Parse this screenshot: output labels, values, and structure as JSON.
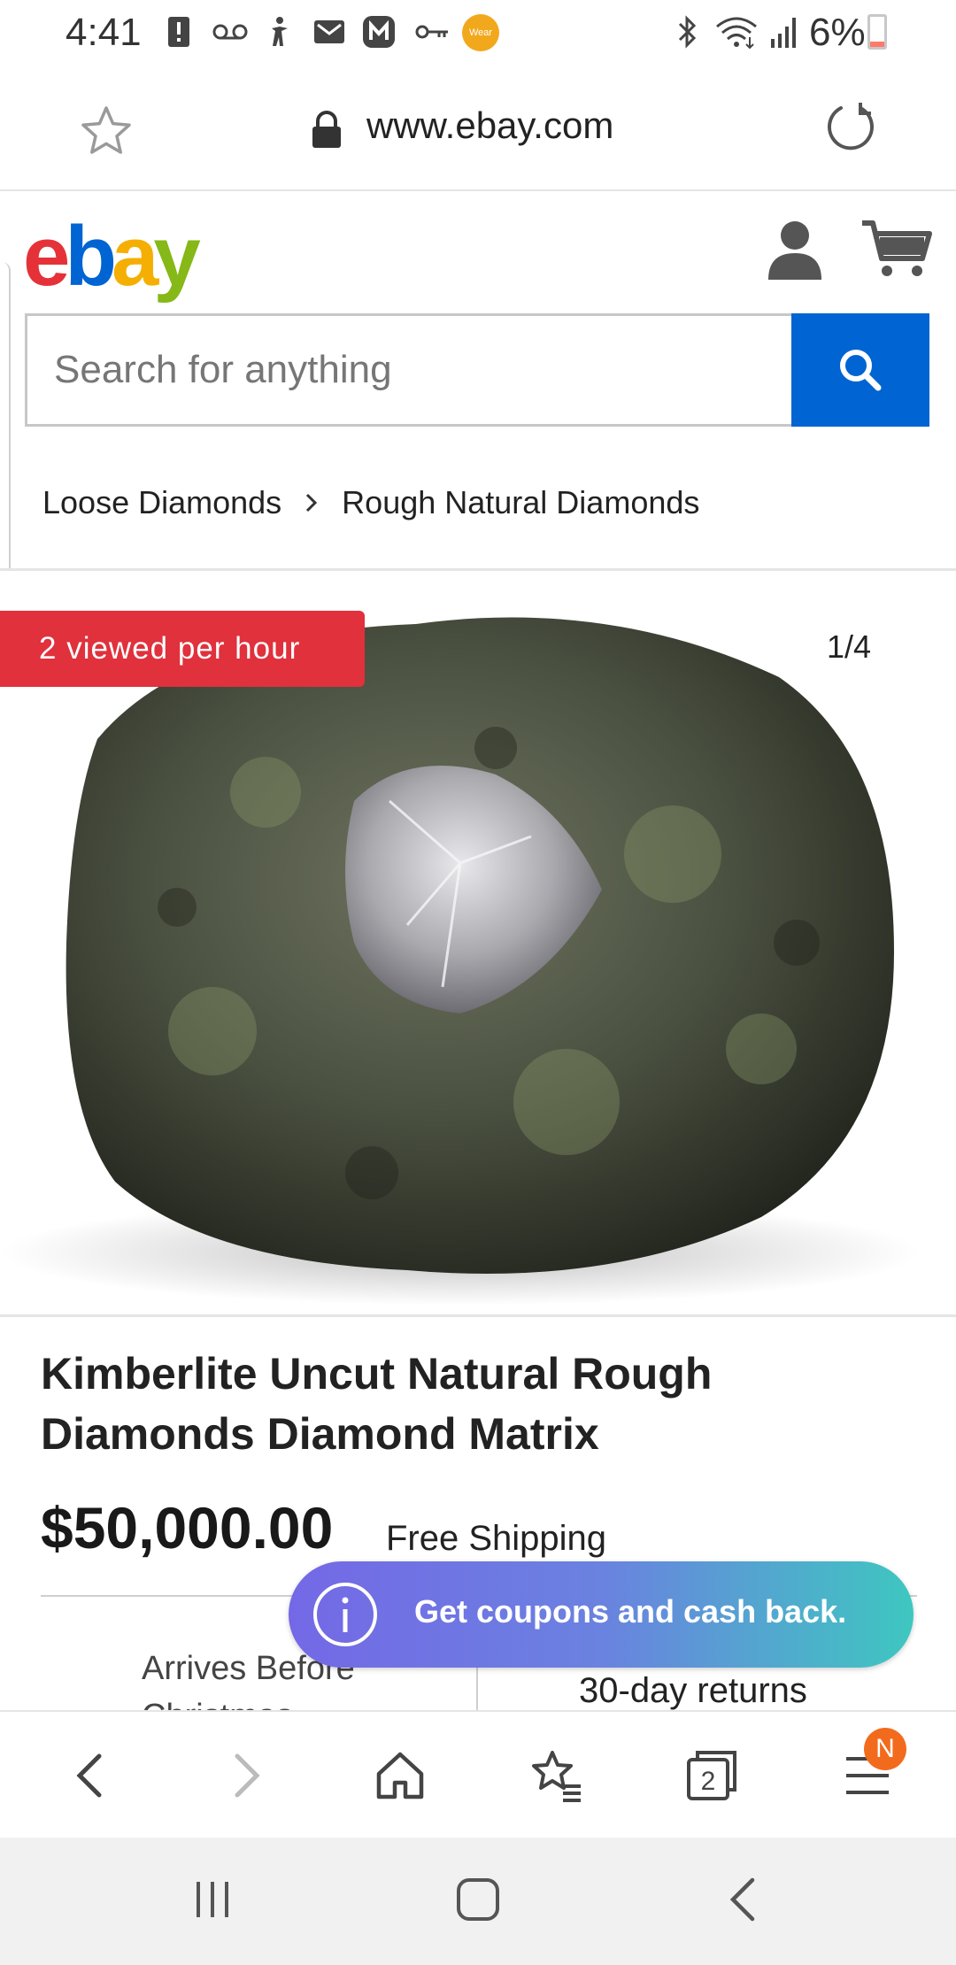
{
  "status_bar": {
    "time": "4:41",
    "battery_percent": "6%",
    "battery_level": 0.06,
    "icons": [
      "alert-icon",
      "voicemail-icon",
      "accessibility-icon",
      "gmail-icon",
      "app-m-icon",
      "key-icon",
      "wear-icon",
      "bluetooth-icon",
      "wifi-icon",
      "signal-icon",
      "battery-icon"
    ],
    "wear_label": "Wear"
  },
  "browser": {
    "url": "www.ebay.com"
  },
  "header": {
    "logo_letters": [
      {
        "char": "e",
        "color": "#e53238"
      },
      {
        "char": "b",
        "color": "#0064d2"
      },
      {
        "char": "a",
        "color": "#f5af02"
      },
      {
        "char": "y",
        "color": "#86b817"
      }
    ]
  },
  "search": {
    "placeholder": "Search for anything"
  },
  "breadcrumb": {
    "items": [
      "Loose Diamonds",
      "Rough Natural Diamonds"
    ]
  },
  "product": {
    "viewed_badge": "2 viewed per hour",
    "image_counter": "1/4",
    "title": "Kimberlite Uncut Natural Rough Diamonds Diamond Matrix",
    "price": "$50,000.00",
    "shipping": "Free Shipping",
    "arrives": "Arrives Before Christmas",
    "returns": "30-day returns"
  },
  "toast": {
    "message": "Get coupons and cash back."
  },
  "browser_nav": {
    "tabs_count": "2",
    "menu_badge": "N"
  },
  "colors": {
    "ebay_blue": "#0064d2",
    "badge_red": "#e0313c",
    "menu_badge_orange": "#f26b1d"
  }
}
